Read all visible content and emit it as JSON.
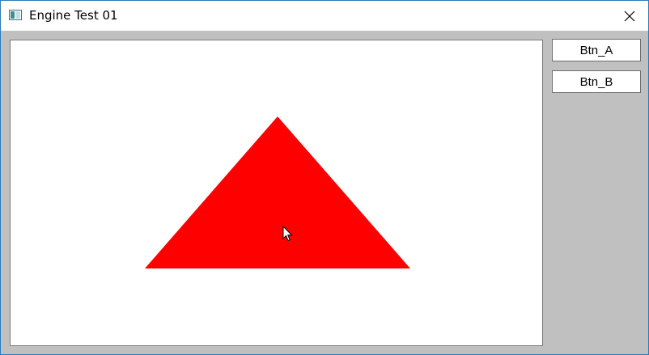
{
  "window": {
    "title": "Engine Test 01",
    "app_icon": "window-app-icon",
    "close_icon": "close-icon"
  },
  "canvas": {
    "background_color": "#ffffff",
    "shape": {
      "type": "triangle",
      "fill_color": "#ff0000"
    },
    "cursor_icon": "arrow-cursor-icon"
  },
  "sidebar": {
    "buttons": [
      {
        "label": "Btn_A"
      },
      {
        "label": "Btn_B"
      }
    ]
  },
  "colors": {
    "client_background": "#c0c0c0",
    "border_accent": "#2b7bb9",
    "triangle": "#ff0000"
  }
}
